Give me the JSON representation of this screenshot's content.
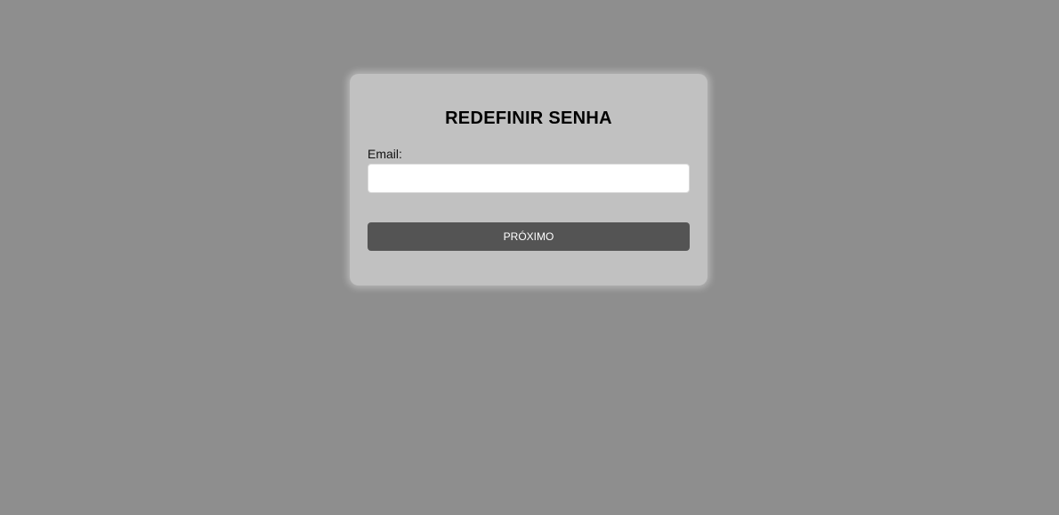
{
  "form": {
    "title": "REDEFINIR SENHA",
    "email_label": "Email:",
    "email_value": "",
    "email_placeholder": "",
    "next_label": "PRÓXIMO"
  },
  "colors": {
    "background": "#8e8e8e",
    "card": "#c1c1c1",
    "button": "#545454",
    "button_text": "#ffffff"
  }
}
